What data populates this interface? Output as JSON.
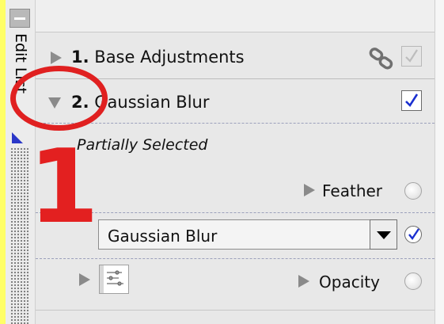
{
  "edit_list_tab": {
    "label": "Edit List",
    "collapse_icon": "minus-icon"
  },
  "steps": [
    {
      "number": "1.",
      "title": "Base Adjustments",
      "expanded": false,
      "link_icon": "chain-link-icon",
      "checked": true,
      "check_enabled": false
    },
    {
      "number": "2.",
      "title": "Gaussian Blur",
      "expanded": true,
      "checked": true,
      "check_enabled": true
    }
  ],
  "step2_detail": {
    "selection_status": "Partially Selected",
    "feather_label": "Feather",
    "mask_select_value": "Gaussian Blur",
    "mask_select_checked": true,
    "opacity_label": "Opacity",
    "mask_thumbnail_icon": "mask-thumbnail-icon"
  },
  "annotation": {
    "callout_number": "1",
    "color": "#e32020"
  },
  "colors": {
    "check_blue": "#1a2fd0",
    "panel_bg": "#e8e8e8",
    "highlight_strip": "#ffff66"
  }
}
